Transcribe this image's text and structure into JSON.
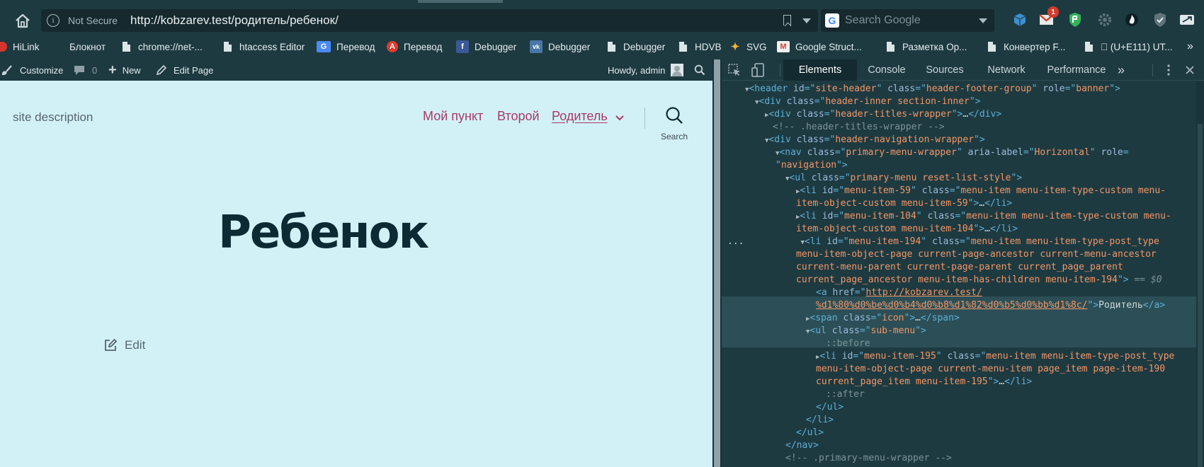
{
  "browser": {
    "address": {
      "security_label": "Not Secure",
      "url": "http://kobzarev.test/родитель/ребенок/"
    },
    "search": {
      "placeholder": "Search Google"
    },
    "extensions": {
      "gmail_badge": "1"
    },
    "bookmarks": [
      {
        "label": "HiLink",
        "icon": "hilink-icon"
      },
      {
        "label": "Блокнот",
        "icon": "none"
      },
      {
        "label": "chrome://net-...",
        "icon": "page-icon"
      },
      {
        "label": "htaccess Editor",
        "icon": "page-icon"
      },
      {
        "label": "Перевод",
        "icon": "google-translate-icon"
      },
      {
        "label": "Перевод",
        "icon": "yandex-translate-icon"
      },
      {
        "label": "Debugger",
        "icon": "facebook-icon"
      },
      {
        "label": "Debugger",
        "icon": "vk-icon"
      },
      {
        "label": "Debugger",
        "icon": "page-icon"
      },
      {
        "label": "HDVB",
        "icon": "page-icon"
      },
      {
        "label": "SVG",
        "icon": "svg-icon"
      },
      {
        "label": "Google Struct...",
        "icon": "gmail-icon"
      },
      {
        "label": "Разметка Op...",
        "icon": "page-icon"
      },
      {
        "label": "Конвертер F...",
        "icon": "page-icon"
      },
      {
        "label": " (U+E111) UT...",
        "icon": "page-icon"
      }
    ],
    "bookmarks_more": "»"
  },
  "wp_admin_bar": {
    "customize": "Customize",
    "comments_count": "0",
    "new": "New",
    "edit_page": "Edit Page",
    "howdy": "Howdy, admin"
  },
  "site": {
    "description": "site description",
    "menu": [
      {
        "label": "Мой пункт"
      },
      {
        "label": "Второй"
      },
      {
        "label": "Родитель",
        "current": true
      }
    ],
    "search_label": "Search",
    "title": "Ребенок",
    "edit_label": "Edit"
  },
  "devtools": {
    "tabs": [
      "Elements",
      "Console",
      "Sources",
      "Network",
      "Performance"
    ],
    "tabs_more": "»",
    "active_tab": "Elements",
    "selected_marker": "== $0",
    "row_dots": "..."
  },
  "colors": {
    "chrome_bg": "#1e3a41",
    "site_bg": "#d2f1f7",
    "menu_link": "#a73a66",
    "title": "#0b2a33",
    "tag": "#5db0d7",
    "attr_name": "#9bbbdc",
    "attr_value": "#f29766"
  }
}
